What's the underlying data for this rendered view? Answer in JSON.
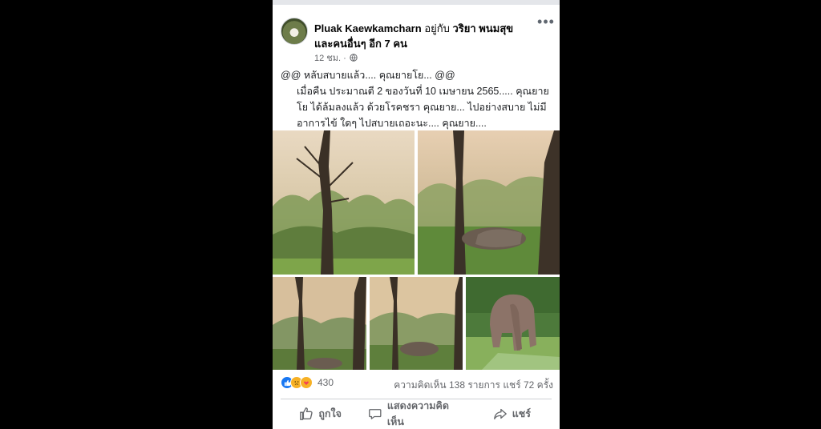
{
  "post": {
    "author": "Pluak Kaewkamcharn",
    "with_word": "อยู่กับ",
    "tagged": "วริยา พนมสุข",
    "others": "และคนอื่นๆ อีก 7 คน",
    "time": "12 ชม. ·",
    "privacy_icon": "globe-icon",
    "more_label": "•••",
    "text_line1": "@@ หลับสบายแล้ว.... คุณยายโย... @@",
    "text_line2": "เมื่อคืน ประมาณตี 2 ของวันที่ 10 เมษายน 2565.....   คุณยายโย ได้ล้มลงแล้ว ด้วยโรคชรา  คุณยาย... ไปอย่างสบาย ไม่มีอาการไข้ ใดๆ ไปสบายเถอะนะ.... คุณยาย...."
  },
  "stats": {
    "reaction_count": "430",
    "comments_shares": "ความคิดเห็น 138 รายการ   แชร์ 72 ครั้ง",
    "reactions": [
      "like-reaction",
      "sad-reaction",
      "care-reaction"
    ]
  },
  "actions": {
    "like": "ถูกใจ",
    "comment": "แสดงความคิดเห็น",
    "share": "แชร์"
  },
  "colors": {
    "like_blue": "#1877f2",
    "meta_gray": "#65676b"
  }
}
